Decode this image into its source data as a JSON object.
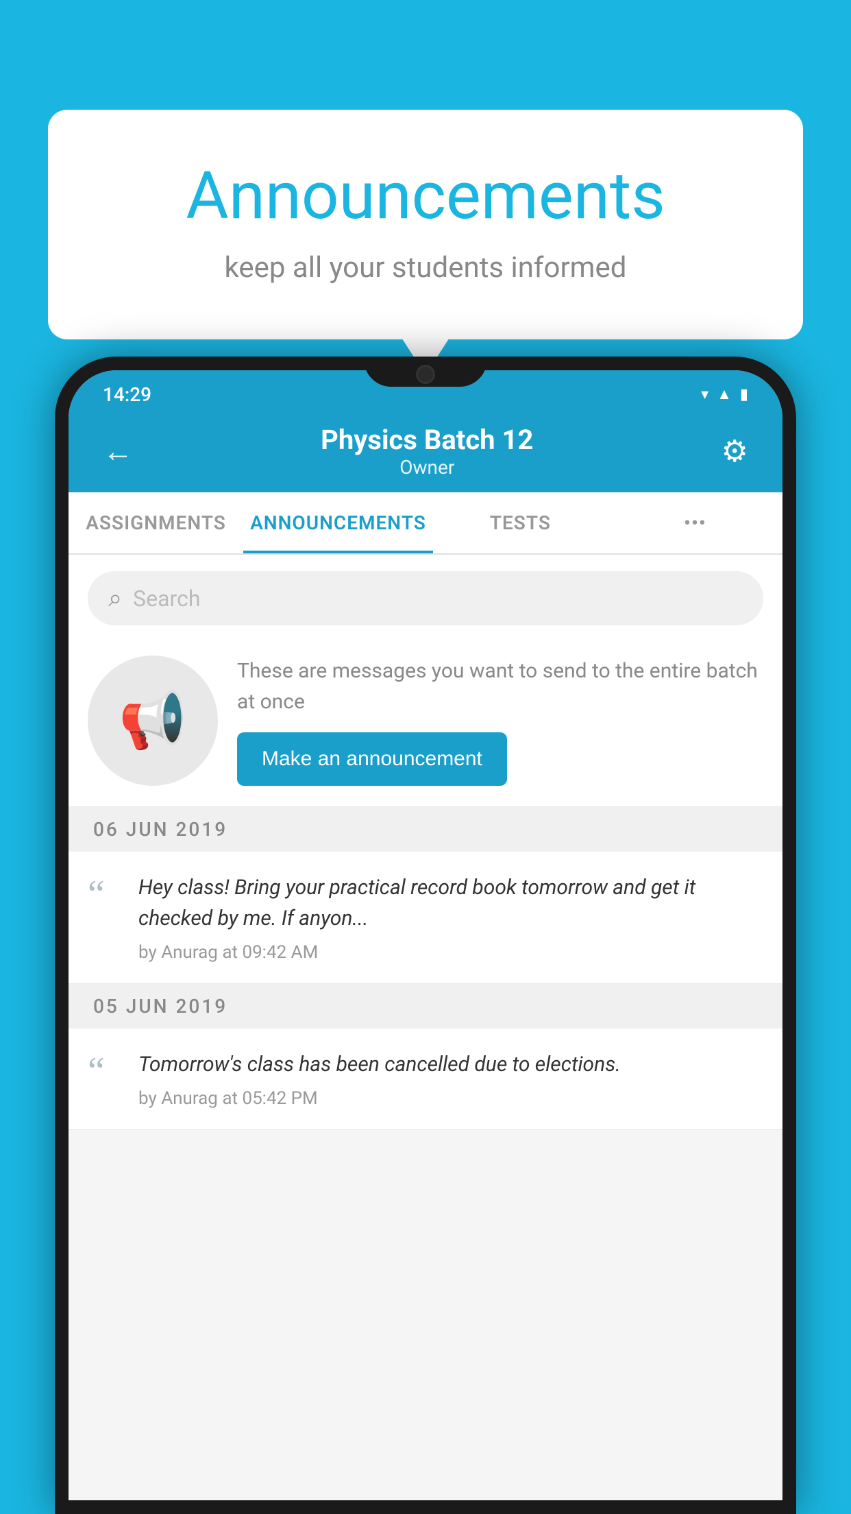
{
  "background_color": "#1ab5e0",
  "bubble": {
    "title": "Announcements",
    "subtitle": "keep all your students informed"
  },
  "status_bar": {
    "time": "14:29",
    "icons": [
      "wifi",
      "signal",
      "battery"
    ]
  },
  "header": {
    "title": "Physics Batch 12",
    "subtitle": "Owner",
    "back_label": "←",
    "gear_label": "⚙"
  },
  "tabs": [
    {
      "label": "ASSIGNMENTS",
      "active": false
    },
    {
      "label": "ANNOUNCEMENTS",
      "active": true
    },
    {
      "label": "TESTS",
      "active": false
    },
    {
      "label": "•••",
      "active": false
    }
  ],
  "search": {
    "placeholder": "Search"
  },
  "promo": {
    "description": "These are messages you want to send to the entire batch at once",
    "button_label": "Make an announcement"
  },
  "announcements": [
    {
      "date": "06  JUN  2019",
      "text": "Hey class! Bring your practical record book tomorrow and get it checked by me. If anyon...",
      "meta": "by Anurag at 09:42 AM"
    },
    {
      "date": "05  JUN  2019",
      "text": "Tomorrow's class has been cancelled due to elections.",
      "meta": "by Anurag at 05:42 PM"
    }
  ]
}
